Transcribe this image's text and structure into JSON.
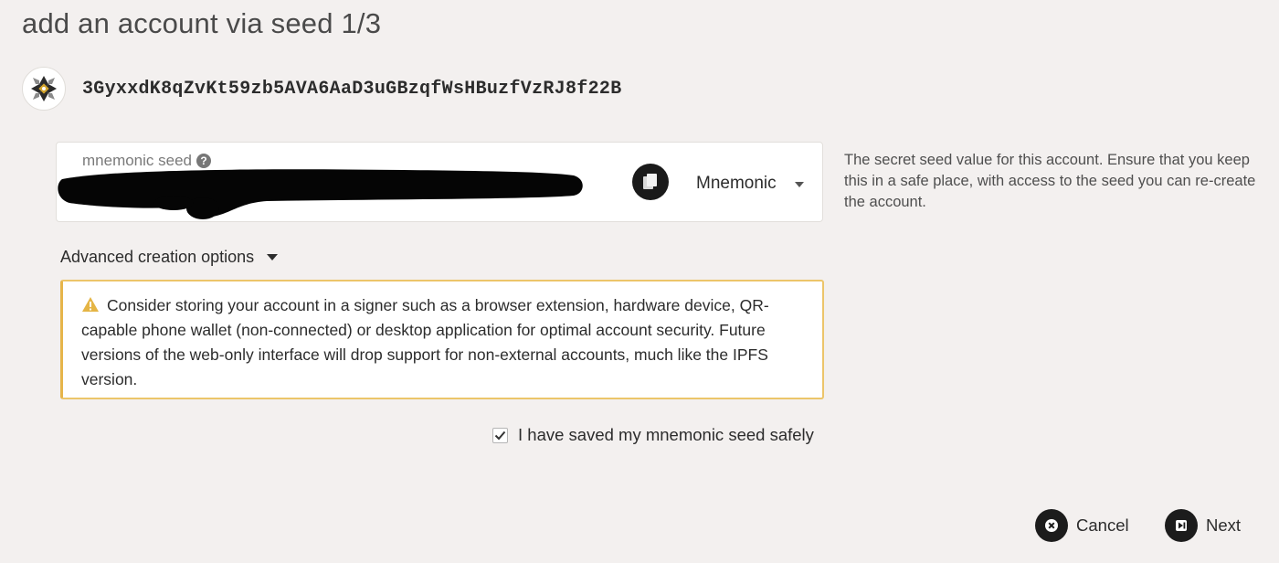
{
  "page": {
    "title": "add an account via seed 1/3"
  },
  "account": {
    "address": "3GyxxdK8qZvKt59zb5AVA6AaD3uGBzqfWsHBuzfVzRJ8f22B",
    "avatar_icon": "identicon-icon"
  },
  "seed": {
    "label": "mnemonic seed",
    "help_icon": "help-circle-icon",
    "value_redacted": true,
    "copy_icon": "copy-icon",
    "type_selected": "Mnemonic",
    "help_text": "The secret seed value for this account. Ensure that you keep this in a safe place, with access to the seed you can re-create the account."
  },
  "advanced": {
    "label": "Advanced creation options"
  },
  "warning": {
    "icon": "warning-icon",
    "text": "Consider storing your account in a signer such as a browser extension, hardware device, QR-capable phone wallet (non-connected) or desktop application for optimal account security. Future versions of the web-only interface will drop support for non-external accounts, much like the IPFS version."
  },
  "confirm": {
    "checked": true,
    "label": "I have saved my mnemonic seed safely"
  },
  "actions": {
    "cancel_label": "Cancel",
    "cancel_icon": "close-icon",
    "next_label": "Next",
    "next_icon": "skip-next-icon"
  },
  "colors": {
    "background": "#f3f0ef",
    "warning_border": "#ecc56a",
    "warning_icon": "#e5b545",
    "button_dark": "#1c1c1c"
  }
}
